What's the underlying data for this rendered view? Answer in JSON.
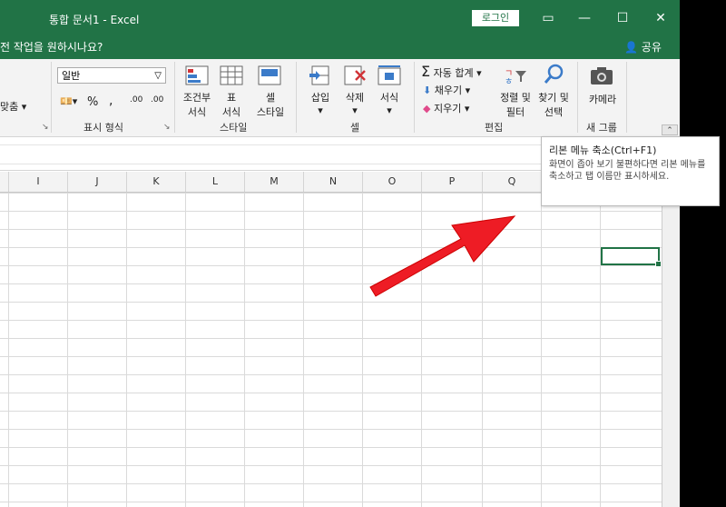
{
  "titlebar": {
    "title": "통합 문서1  -  Excel",
    "login_label": "로그인",
    "colors": {
      "brand": "#217346"
    }
  },
  "tellbar": {
    "tell_text": "전 작업을 원하시나요?",
    "share_label": "공유"
  },
  "ribbon": {
    "alignment_partial": "맞춤",
    "number_format_value": "일반",
    "percent_label": "%",
    "comma_label": ",",
    "decimal_increase": ".00",
    "decimal_decrease": ".00",
    "groups": {
      "number": "표시 형식",
      "style": "스타일",
      "cells": "셀",
      "editing": "편집",
      "camera": "새 그룹"
    },
    "buttons": {
      "conditional": "조건부\n서식",
      "table": "표\n서식",
      "cell_style": "셀\n스타일",
      "insert": "삽입",
      "delete": "삭제",
      "format": "서식",
      "autosum": "자동 합계",
      "fill": "채우기",
      "clear": "지우기",
      "sort": "정렬 및\n필터",
      "find": "찾기 및\n선택",
      "camera": "카메라"
    }
  },
  "columns": [
    "I",
    "J",
    "K",
    "L",
    "M",
    "N",
    "O",
    "P",
    "Q"
  ],
  "tooltip": {
    "title": "리본 메뉴 축소(Ctrl+F1)",
    "body": "화면이 좁아 보기 불편하다면 리본 메뉴를 축소하고 탭 이름만 표시하세요."
  }
}
